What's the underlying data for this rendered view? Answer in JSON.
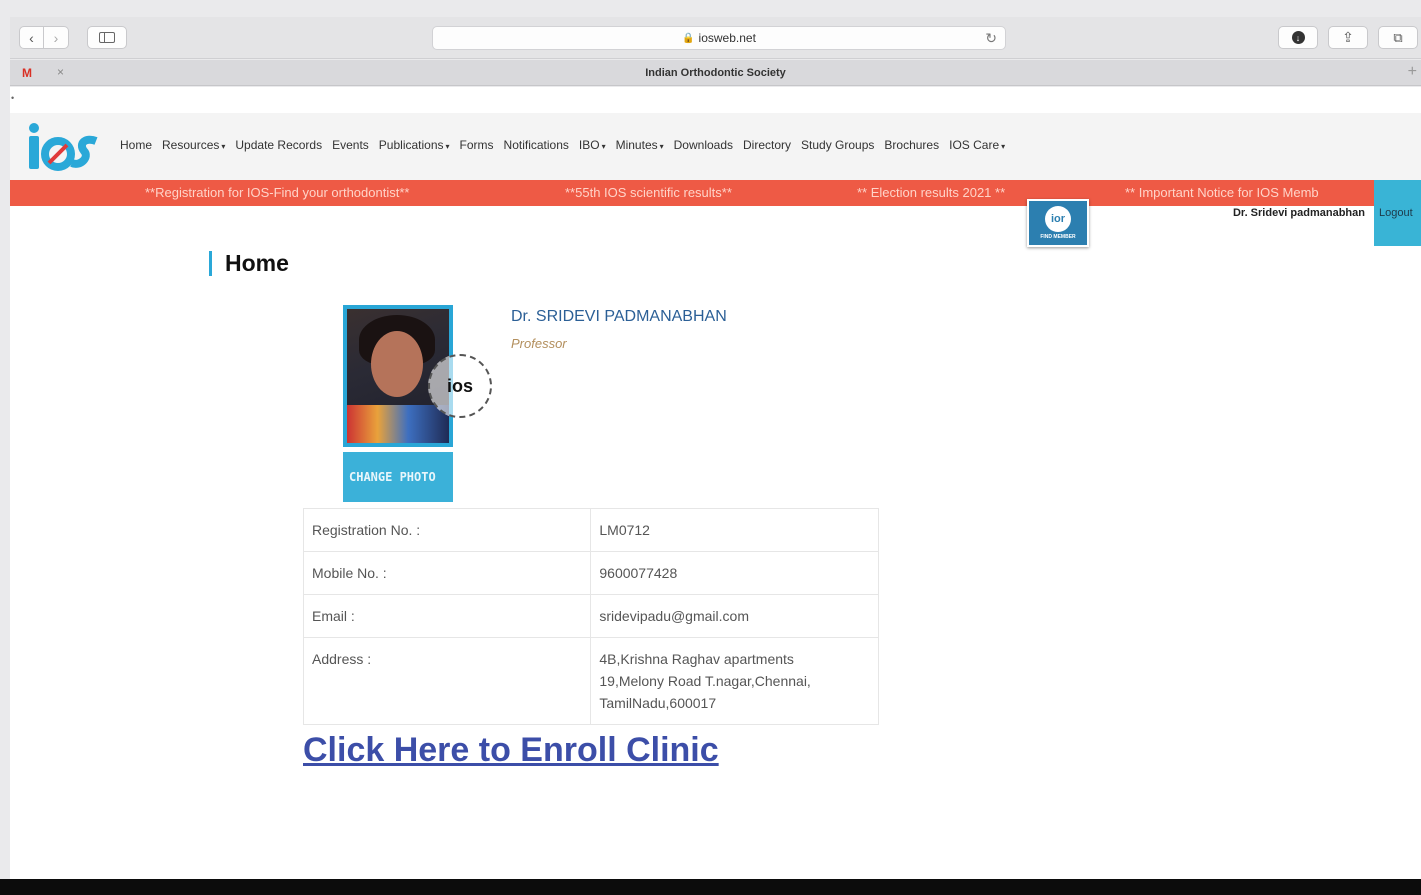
{
  "browser": {
    "url": "iosweb.net",
    "tab_title": "Indian Orthodontic Society",
    "gmail_mark": "M",
    "back_glyph": "‹",
    "forward_glyph": "›",
    "close_glyph": "×",
    "new_tab_glyph": "+",
    "reload_glyph": "↻",
    "lock_glyph": "🔒",
    "share_glyph": "⇪",
    "tabs_glyph": "⧉",
    "download_glyph": "↓"
  },
  "site": {
    "logo_text": "ios",
    "colors": {
      "accent": "#2aa8d8",
      "ticker": "#ee5a45",
      "link": "#3c4ea8",
      "name": "#2b5f96"
    },
    "nav": [
      {
        "label": "Home",
        "dropdown": false
      },
      {
        "label": "Resources",
        "dropdown": true
      },
      {
        "label": "Update Records",
        "dropdown": false
      },
      {
        "label": "Events",
        "dropdown": false
      },
      {
        "label": "Publications",
        "dropdown": true
      },
      {
        "label": "Forms",
        "dropdown": false
      },
      {
        "label": "Notifications",
        "dropdown": false
      },
      {
        "label": "IBO",
        "dropdown": true
      },
      {
        "label": "Minutes",
        "dropdown": true
      },
      {
        "label": "Downloads",
        "dropdown": false
      },
      {
        "label": "Directory",
        "dropdown": false
      },
      {
        "label": "Study Groups",
        "dropdown": false
      },
      {
        "label": "Brochures",
        "dropdown": false
      },
      {
        "label": "IOS Care",
        "dropdown": true
      }
    ],
    "caret_glyph": "▾",
    "ticker": [
      "**Registration for IOS-Find your orthodontist**",
      "**55th IOS scientific results**",
      "** Election results 2021 **",
      "** Important Notice for IOS Memb"
    ],
    "find_member_icon_text": "ior",
    "find_member_label": "FIND MEMBER",
    "logged_in_user": "Dr. Sridevi padmanabhan",
    "logout_label": "Logout"
  },
  "main": {
    "title": "Home",
    "profile": {
      "name": "Dr. SRIDEVI PADMANABHAN",
      "designation": "Professor",
      "seal_text": "ios",
      "change_photo_label": "CHANGE PHOTO"
    },
    "details": [
      {
        "label": "Registration No. :",
        "value": "LM0712"
      },
      {
        "label": "Mobile No. :",
        "value": "9600077428"
      },
      {
        "label": "Email :",
        "value": "sridevipadu@gmail.com"
      },
      {
        "label": "Address :",
        "value_lines": [
          "4B,Krishna Raghav apartments",
          "19,Melony Road T.nagar,Chennai,",
          "TamilNadu,600017"
        ]
      }
    ],
    "enroll_link": "Click Here to Enroll Clinic"
  }
}
